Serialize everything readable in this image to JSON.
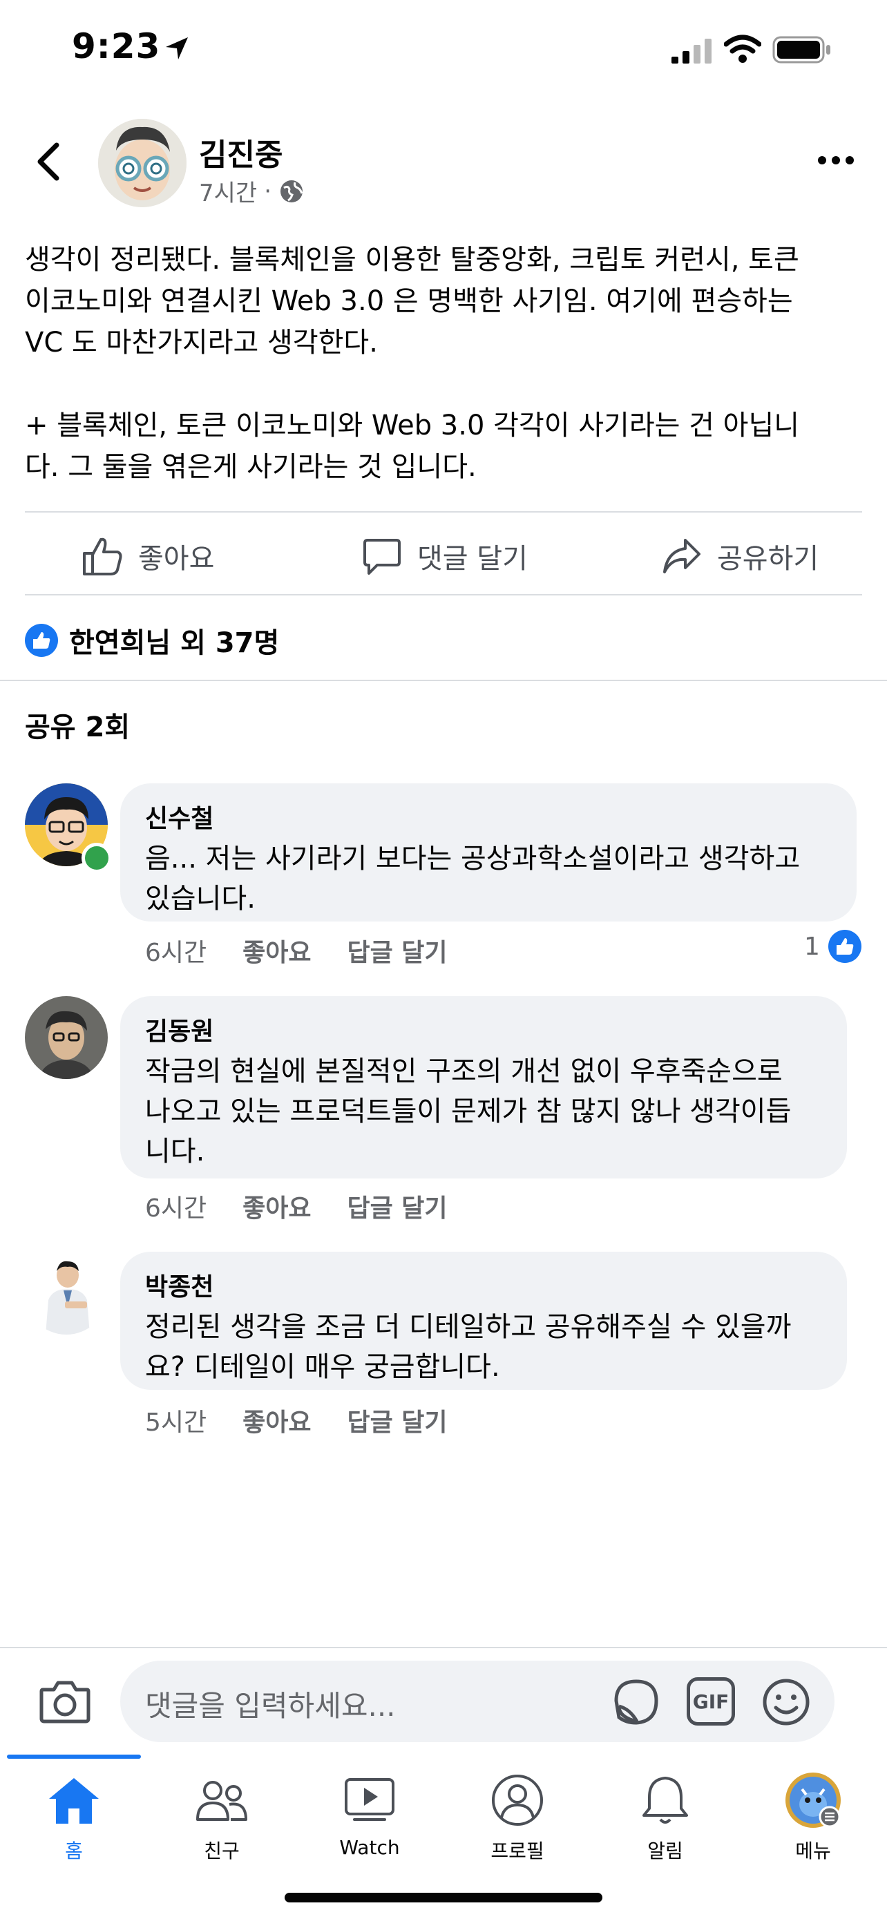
{
  "status_bar": {
    "time": "9:23"
  },
  "post": {
    "author": "김진중",
    "time": "7시간",
    "text": "생각이 정리됐다. 블록체인을 이용한 탈중앙화, 크립토 커런시, 토큰\n이코노미와 연결시킨 Web 3.0 은 명백한 사기임. 여기에 편승하는\nVC 도 마찬가지라고 생각한다.\n\n+ 블록체인, 토큰 이코노미와 Web 3.0 각각이 사기라는 건 아닙니\n다. 그 둘을 엮은게 사기라는 것 입니다."
  },
  "actions": {
    "like": "좋아요",
    "comment": "댓글 달기",
    "share": "공유하기"
  },
  "reactions": {
    "summary": "한연희님 외 37명"
  },
  "shares": {
    "label": "공유 2회"
  },
  "comments": [
    {
      "name": "신수철",
      "text": "음... 저는 사기라기 보다는 공상과학소설이라고 생각하고\n있습니다.",
      "time": "6시간",
      "like": "좋아요",
      "reply": "답글 달기",
      "like_count": "1"
    },
    {
      "name": "김동원",
      "text": "작금의 현실에 본질적인 구조의 개선 없이 우후죽순으로\n나오고 있는 프로덕트들이 문제가 참 많지 않나 생각이듭\n니다.",
      "time": "6시간",
      "like": "좋아요",
      "reply": "답글 달기"
    },
    {
      "name": "박종천",
      "text": "정리된 생각을 조금 더 디테일하고 공유해주실 수 있을까\n요? 디테일이 매우 궁금합니다.",
      "time": "5시간",
      "like": "좋아요",
      "reply": "답글 달기"
    }
  ],
  "composer": {
    "placeholder": "댓글을 입력하세요...",
    "gif": "GIF"
  },
  "tabs": [
    {
      "label": "홈",
      "icon": "home-icon",
      "active": true
    },
    {
      "label": "친구",
      "icon": "friends-icon"
    },
    {
      "label": "Watch",
      "icon": "watch-icon"
    },
    {
      "label": "프로필",
      "icon": "profile-icon"
    },
    {
      "label": "알림",
      "icon": "bell-icon"
    },
    {
      "label": "메뉴",
      "icon": "menu-avatar-icon"
    }
  ],
  "colors": {
    "accent": "#1877f2",
    "online": "#31a24c",
    "bubble": "#f0f2f5",
    "muted": "#65676b"
  }
}
